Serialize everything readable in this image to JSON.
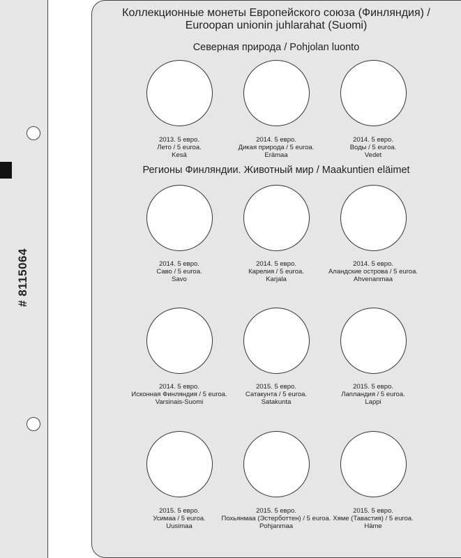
{
  "page": {
    "catalog_number": "# 8115064",
    "title_line1": "Коллекционные монеты Европейского союза (Финляндия) /",
    "title_line2": "Euroopan unionin juhlarahat (Suomi)"
  },
  "sections": [
    {
      "title": "Северная природа / Pohjolan luonto",
      "coins": [
        {
          "line1": "2013. 5 евро.",
          "line2": "Лето / 5 euroa.",
          "line3": "Kesä"
        },
        {
          "line1": "2014. 5 евро.",
          "line2": "Дикая природа / 5 euroa.",
          "line3": "Erämaa"
        },
        {
          "line1": "2014. 5 евро.",
          "line2": "Воды / 5 euroa.",
          "line3": "Vedet"
        }
      ]
    },
    {
      "title": "Регионы Финляндии. Животный мир / Maakuntien eläimet",
      "coins": [
        {
          "line1": "2014. 5 евро.",
          "line2": "Саво / 5 euroa.",
          "line3": "Savo"
        },
        {
          "line1": "2014. 5 евро.",
          "line2": "Карелия / 5 euroa.",
          "line3": "Karjala"
        },
        {
          "line1": "2014. 5 евро.",
          "line2": "Аландские острова / 5 euroa.",
          "line3": "Ahvenanmaa"
        },
        {
          "line1": "2014. 5 евро.",
          "line2": "Исконная Финляндия / 5 euroa.",
          "line3": "Varsinais-Suomi"
        },
        {
          "line1": "2015. 5 евро.",
          "line2": "Сатакунта / 5 euroa.",
          "line3": "Satakunta"
        },
        {
          "line1": "2015. 5 евро.",
          "line2": "Лапландия / 5 euroa.",
          "line3": "Lappi"
        },
        {
          "line1": "2015. 5 евро.",
          "line2": "Усимаа / 5 euroa.",
          "line3": "Uusimaa"
        },
        {
          "line1": "2015. 5 евро.",
          "line2": "Похьянмаа (Эстерботтен) / 5 euroa.",
          "line3": "Pohjanmaa"
        },
        {
          "line1": "2015. 5 евро.",
          "line2": "Хяме (Тавастия) / 5 euroa.",
          "line3": "Häme"
        }
      ]
    }
  ]
}
